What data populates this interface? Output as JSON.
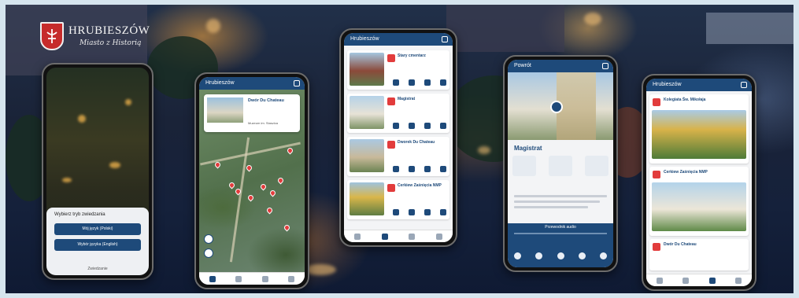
{
  "brand": {
    "name": "HRUBIESZÓW",
    "tagline": "Miasto z Historią"
  },
  "phone1": {
    "prompt": "Wybierz tryb zwiedzania",
    "button1": "Mój język (Polski)",
    "button2": "Wybór języka (English)",
    "footer": "Zwiedzanie"
  },
  "phone2": {
    "title": "Hrubieszów",
    "card_title": "Dwór Du Chateau",
    "card_sub": "Muzeum im. Staszica"
  },
  "phone3": {
    "title": "Hrubieszów",
    "items": [
      {
        "title": "Stary cmentarz"
      },
      {
        "title": "Magistrat"
      },
      {
        "title": "Dworek Du Chateau"
      },
      {
        "title": "Cerkiew Zaśnięcia NMP"
      }
    ]
  },
  "phone4": {
    "back": "Powrót",
    "name": "Magistrat",
    "audio": "Przewodnik audio"
  },
  "phone5": {
    "title": "Hrubieszów",
    "items": [
      {
        "title": "Kolegiata Św. Mikołaja"
      },
      {
        "title": "Cerkiew Zaśnięcia NMP"
      },
      {
        "title": "Dwór Du Chateau"
      }
    ]
  }
}
